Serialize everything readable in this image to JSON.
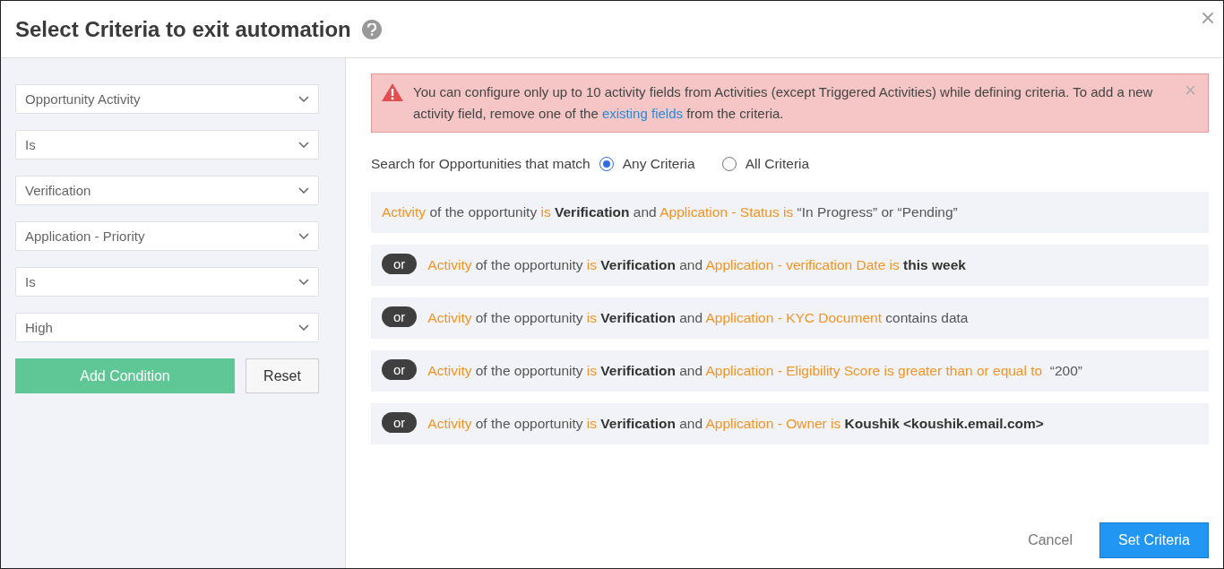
{
  "dialog": {
    "title": "Select Criteria to exit automation"
  },
  "condition_builder": {
    "dropdowns": [
      "Opportunity Activity",
      "Is",
      "Verification",
      "Application - Priority",
      "Is",
      "High"
    ],
    "add_button": "Add Condition",
    "reset_button": "Reset"
  },
  "alert": {
    "text_before": "You can configure only up to 10 activity fields from Activities (except Triggered Activities) while defining criteria. To add a new activity field, remove one of the ",
    "link": "existing fields",
    "text_after": " from the criteria."
  },
  "match": {
    "label": "Search for Opportunities that match",
    "options": [
      {
        "label": "Any Criteria",
        "selected": true
      },
      {
        "label": "All Criteria",
        "selected": false
      }
    ]
  },
  "criteria": [
    {
      "segments": [
        {
          "kind": "field",
          "text": "Activity"
        },
        {
          "kind": "plain",
          "text": " of the opportunity "
        },
        {
          "kind": "field",
          "text": "is"
        },
        {
          "kind": "value",
          "text": " Verification"
        },
        {
          "kind": "plain",
          "text": " and "
        },
        {
          "kind": "field",
          "text": "Application - Status is"
        },
        {
          "kind": "plain",
          "text": " “In Progress” or “Pending”"
        }
      ]
    },
    {
      "connector": "or",
      "segments": [
        {
          "kind": "field",
          "text": "Activity"
        },
        {
          "kind": "plain",
          "text": " of the opportunity "
        },
        {
          "kind": "field",
          "text": "is"
        },
        {
          "kind": "value",
          "text": " Verification"
        },
        {
          "kind": "plain",
          "text": " and "
        },
        {
          "kind": "field",
          "text": "Application - verification Date is"
        },
        {
          "kind": "value",
          "text": " this week"
        }
      ]
    },
    {
      "connector": "or",
      "segments": [
        {
          "kind": "field",
          "text": "Activity"
        },
        {
          "kind": "plain",
          "text": " of the opportunity "
        },
        {
          "kind": "field",
          "text": "is"
        },
        {
          "kind": "value",
          "text": " Verification"
        },
        {
          "kind": "plain",
          "text": " and "
        },
        {
          "kind": "field",
          "text": "Application - KYC Document"
        },
        {
          "kind": "plain",
          "text": " contains data"
        }
      ]
    },
    {
      "connector": "or",
      "segments": [
        {
          "kind": "field",
          "text": "Activity"
        },
        {
          "kind": "plain",
          "text": " of the opportunity "
        },
        {
          "kind": "field",
          "text": "is"
        },
        {
          "kind": "value",
          "text": " Verification"
        },
        {
          "kind": "plain",
          "text": " and "
        },
        {
          "kind": "field",
          "text": "Application - Eligibility Score is greater than or equal to"
        },
        {
          "kind": "plain",
          "text": "  “200”"
        }
      ]
    },
    {
      "connector": "or",
      "segments": [
        {
          "kind": "field",
          "text": "Activity"
        },
        {
          "kind": "plain",
          "text": " of the opportunity "
        },
        {
          "kind": "field",
          "text": "is"
        },
        {
          "kind": "value",
          "text": " Verification"
        },
        {
          "kind": "plain",
          "text": " and "
        },
        {
          "kind": "field",
          "text": "Application - Owner is"
        },
        {
          "kind": "value",
          "text": " Koushik <koushik.email.com>"
        }
      ]
    }
  ],
  "footer": {
    "cancel": "Cancel",
    "submit": "Set Criteria"
  }
}
